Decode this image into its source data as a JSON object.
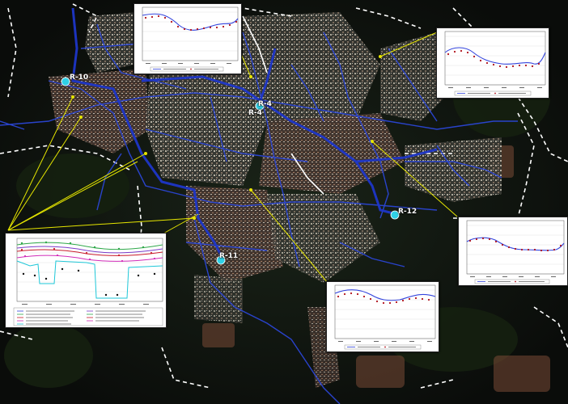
{
  "map": {
    "background": "#0c0f0c",
    "network_color": "#2b46d6",
    "main_pipe_color": "#1e36c8",
    "boundary_color": "#ffffff",
    "pointer_color": "#e6e600",
    "reservoir_color": "#2fd0e6"
  },
  "reservoirs": [
    {
      "label": "R-10"
    },
    {
      "label": "R-4"
    },
    {
      "label": "R-4"
    },
    {
      "label": "R-12"
    },
    {
      "label": "R-11"
    }
  ],
  "legends": {
    "sim_color": "#3344dd",
    "obs_color": "#b0101a"
  }
}
